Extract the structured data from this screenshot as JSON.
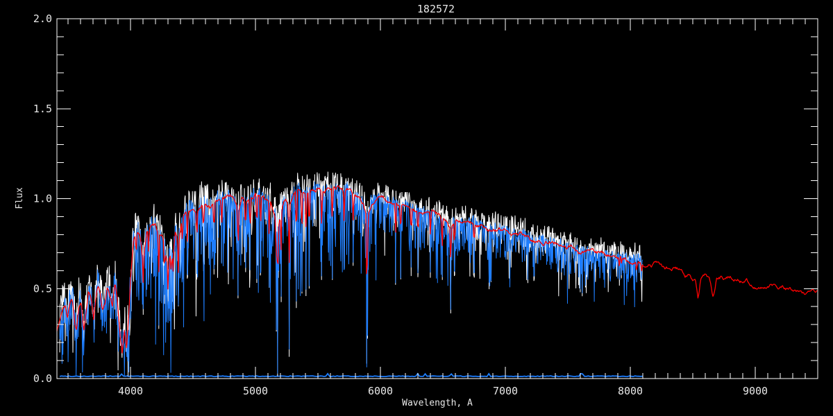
{
  "chart_data": {
    "type": "line",
    "title": "182572",
    "xlabel": "Wavelength, A",
    "ylabel": "Flux",
    "xlim": [
      3411,
      9500
    ],
    "ylim": [
      0.0,
      2.0
    ],
    "x_major_ticks": [
      4000,
      5000,
      6000,
      7000,
      8000,
      9000
    ],
    "x_minor_step": 100,
    "y_major_ticks": [
      0.0,
      0.5,
      1.0,
      1.5,
      2.0
    ],
    "y_tick_labels": [
      "0.0",
      "0.5",
      "1.0",
      "1.5",
      "2.0"
    ],
    "y_minor_step": 0.1,
    "legend": "none",
    "grid": false,
    "colors": {
      "background": "#000000",
      "axis": "#ffffff",
      "text": "#e8e8e8",
      "observed": "#1e7eff",
      "raw": "#ffffff",
      "model": "#ff0000"
    },
    "series": [
      {
        "name": "model-template",
        "color": "#ff0000",
        "kind": "model",
        "points": [
          [
            3412,
            0.26
          ],
          [
            3435,
            0.33
          ],
          [
            3455,
            0.38
          ],
          [
            3475,
            0.4
          ],
          [
            3495,
            0.34
          ],
          [
            3515,
            0.42
          ],
          [
            3535,
            0.44
          ],
          [
            3555,
            0.31
          ],
          [
            3570,
            0.28
          ],
          [
            3585,
            0.4
          ],
          [
            3605,
            0.43
          ],
          [
            3625,
            0.27
          ],
          [
            3645,
            0.36
          ],
          [
            3665,
            0.48
          ],
          [
            3685,
            0.44
          ],
          [
            3705,
            0.33
          ],
          [
            3725,
            0.46
          ],
          [
            3740,
            0.52
          ],
          [
            3755,
            0.48
          ],
          [
            3775,
            0.38
          ],
          [
            3795,
            0.42
          ],
          [
            3815,
            0.52
          ],
          [
            3835,
            0.46
          ],
          [
            3855,
            0.4
          ],
          [
            3875,
            0.52
          ],
          [
            3895,
            0.42
          ],
          [
            3915,
            0.26
          ],
          [
            3933,
            0.15
          ],
          [
            3950,
            0.28
          ],
          [
            3968,
            0.18
          ],
          [
            3985,
            0.35
          ],
          [
            4005,
            0.6
          ],
          [
            4025,
            0.77
          ],
          [
            4050,
            0.82
          ],
          [
            4075,
            0.8
          ],
          [
            4101,
            0.66
          ],
          [
            4130,
            0.82
          ],
          [
            4160,
            0.85
          ],
          [
            4200,
            0.86
          ],
          [
            4230,
            0.8
          ],
          [
            4260,
            0.78
          ],
          [
            4300,
            0.63
          ],
          [
            4320,
            0.7
          ],
          [
            4340,
            0.68
          ],
          [
            4360,
            0.82
          ],
          [
            4383,
            0.75
          ],
          [
            4410,
            0.88
          ],
          [
            4440,
            0.92
          ],
          [
            4470,
            0.94
          ],
          [
            4500,
            0.95
          ],
          [
            4530,
            0.93
          ],
          [
            4570,
            0.97
          ],
          [
            4600,
            0.98
          ],
          [
            4640,
            0.96
          ],
          [
            4680,
            0.98
          ],
          [
            4720,
            1.0
          ],
          [
            4760,
            1.01
          ],
          [
            4800,
            1.02
          ],
          [
            4830,
            1.0
          ],
          [
            4861,
            0.93
          ],
          [
            4890,
            1.0
          ],
          [
            4920,
            0.98
          ],
          [
            4957,
            1.0
          ],
          [
            5000,
            1.02
          ],
          [
            5040,
            1.01
          ],
          [
            5080,
            0.99
          ],
          [
            5120,
            0.98
          ],
          [
            5167,
            0.89
          ],
          [
            5185,
            0.86
          ],
          [
            5210,
            0.96
          ],
          [
            5240,
            1.0
          ],
          [
            5270,
            0.94
          ],
          [
            5300,
            1.03
          ],
          [
            5340,
            1.06
          ],
          [
            5380,
            1.04
          ],
          [
            5420,
            1.03
          ],
          [
            5460,
            1.05
          ],
          [
            5500,
            1.06
          ],
          [
            5540,
            1.04
          ],
          [
            5580,
            1.05
          ],
          [
            5620,
            1.05
          ],
          [
            5660,
            1.06
          ],
          [
            5700,
            1.04
          ],
          [
            5740,
            1.05
          ],
          [
            5780,
            1.03
          ],
          [
            5820,
            1.01
          ],
          [
            5860,
            0.98
          ],
          [
            5893,
            0.89
          ],
          [
            5930,
            0.99
          ],
          [
            5970,
            1.0
          ],
          [
            6010,
            1.0
          ],
          [
            6060,
            0.99
          ],
          [
            6110,
            0.97
          ],
          [
            6160,
            0.96
          ],
          [
            6220,
            0.95
          ],
          [
            6280,
            0.93
          ],
          [
            6340,
            0.92
          ],
          [
            6400,
            0.91
          ],
          [
            6460,
            0.9
          ],
          [
            6520,
            0.89
          ],
          [
            6563,
            0.84
          ],
          [
            6610,
            0.89
          ],
          [
            6670,
            0.88
          ],
          [
            6730,
            0.87
          ],
          [
            6800,
            0.85
          ],
          [
            6870,
            0.83
          ],
          [
            6940,
            0.83
          ],
          [
            7000,
            0.82
          ],
          [
            7060,
            0.81
          ],
          [
            7130,
            0.8
          ],
          [
            7200,
            0.78
          ],
          [
            7270,
            0.77
          ],
          [
            7340,
            0.76
          ],
          [
            7410,
            0.75
          ],
          [
            7480,
            0.74
          ],
          [
            7550,
            0.72
          ],
          [
            7620,
            0.7
          ],
          [
            7690,
            0.71
          ],
          [
            7760,
            0.69
          ],
          [
            7830,
            0.68
          ],
          [
            7900,
            0.67
          ],
          [
            7970,
            0.66
          ],
          [
            8040,
            0.66
          ],
          [
            8100,
            0.65
          ],
          [
            8160,
            0.64
          ],
          [
            8220,
            0.63
          ],
          [
            8280,
            0.62
          ],
          [
            8340,
            0.61
          ],
          [
            8400,
            0.6
          ],
          [
            8440,
            0.58
          ],
          [
            8470,
            0.59
          ],
          [
            8498,
            0.55
          ],
          [
            8520,
            0.58
          ],
          [
            8542,
            0.47
          ],
          [
            8562,
            0.57
          ],
          [
            8600,
            0.58
          ],
          [
            8630,
            0.57
          ],
          [
            8662,
            0.46
          ],
          [
            8690,
            0.56
          ],
          [
            8720,
            0.57
          ],
          [
            8760,
            0.56
          ],
          [
            8800,
            0.57
          ],
          [
            8840,
            0.55
          ],
          [
            8880,
            0.54
          ],
          [
            8920,
            0.55
          ],
          [
            8960,
            0.53
          ],
          [
            9000,
            0.52
          ],
          [
            9050,
            0.51
          ],
          [
            9100,
            0.52
          ],
          [
            9150,
            0.52
          ],
          [
            9200,
            0.51
          ],
          [
            9250,
            0.5
          ],
          [
            9300,
            0.5
          ],
          [
            9350,
            0.48
          ],
          [
            9395,
            0.46
          ],
          [
            9430,
            0.49
          ],
          [
            9470,
            0.48
          ],
          [
            9500,
            0.48
          ]
        ]
      },
      {
        "name": "observed-raw",
        "color": "#ffffff",
        "kind": "noisy",
        "range": [
          3433,
          8100
        ],
        "seed": 7,
        "deep_prob": 0.03,
        "up_boost": 0.05,
        "down_scale": 0.85,
        "offset": 0.012,
        "line_extra_depth": 0.015
      },
      {
        "name": "observed-corrected",
        "color": "#1e7eff",
        "kind": "noisy",
        "range": [
          3433,
          8100
        ],
        "seed": 42,
        "deep_prob": 0.045,
        "up_boost": 0,
        "down_scale": 1,
        "offset": 0,
        "line_extra_depth": 0
      },
      {
        "name": "zero-baseline",
        "color": "#1e7eff",
        "kind": "baseline",
        "range": [
          3433,
          8100
        ],
        "level": 0.013,
        "spikes": [
          3930,
          5577,
          6300,
          6364,
          6563,
          6867,
          7600,
          7621
        ]
      }
    ],
    "noise_regions": [
      [
        3980,
        0.1,
        0.22
      ],
      [
        4700,
        0.075,
        0.4
      ],
      [
        5400,
        0.05,
        0.33
      ],
      [
        6000,
        0.045,
        0.27
      ],
      [
        6800,
        0.04,
        0.22
      ],
      [
        7600,
        0.04,
        0.19
      ],
      [
        8101,
        0.04,
        0.16
      ]
    ],
    "absorption_lines": [
      [
        3933,
        0.15,
        "s"
      ],
      [
        3968,
        0.17,
        "s"
      ],
      [
        4045,
        0.55,
        "s"
      ],
      [
        4101,
        0.38,
        "s"
      ],
      [
        4144,
        0.52,
        "s"
      ],
      [
        4226,
        0.28,
        "s"
      ],
      [
        4271,
        0.45,
        "s"
      ],
      [
        4300,
        0.32,
        "s"
      ],
      [
        4325,
        0.42,
        "s"
      ],
      [
        4340,
        0.44,
        "s"
      ],
      [
        4383,
        0.4,
        "s"
      ],
      [
        4415,
        0.55,
        "s"
      ],
      [
        4455,
        0.58,
        "s"
      ],
      [
        4531,
        0.58,
        "s"
      ],
      [
        4584,
        0.62,
        "s"
      ],
      [
        4668,
        0.6,
        "s"
      ],
      [
        4730,
        0.65,
        "s"
      ],
      [
        4861,
        0.45,
        "s"
      ],
      [
        4920,
        0.62,
        "s"
      ],
      [
        4957,
        0.6,
        "s"
      ],
      [
        5010,
        0.55,
        "s"
      ],
      [
        5041,
        0.6,
        "s"
      ],
      [
        5110,
        0.52,
        "s"
      ],
      [
        5167,
        0.28,
        "s"
      ],
      [
        5178,
        0.02,
        "s"
      ],
      [
        5205,
        0.45,
        "s"
      ],
      [
        5270,
        0.15,
        "s"
      ],
      [
        5328,
        0.42,
        "s"
      ],
      [
        5371,
        0.5,
        "s"
      ],
      [
        5405,
        0.48,
        "s"
      ],
      [
        5430,
        0.52,
        "s"
      ],
      [
        5530,
        0.58,
        "s"
      ],
      [
        5615,
        0.55,
        "s"
      ],
      [
        5710,
        0.62,
        "s"
      ],
      [
        5782,
        0.65,
        "s"
      ],
      [
        5890,
        0.08,
        "s"
      ],
      [
        5896,
        0.22,
        "s"
      ],
      [
        6122,
        0.55,
        "s"
      ],
      [
        6162,
        0.55,
        "s"
      ],
      [
        6246,
        0.6,
        "s"
      ],
      [
        6300,
        0.58,
        "s"
      ],
      [
        6400,
        0.58,
        "s"
      ],
      [
        6495,
        0.55,
        "s"
      ],
      [
        6563,
        0.37,
        "s"
      ],
      [
        6593,
        0.6,
        "s"
      ],
      [
        6750,
        0.58,
        "s"
      ],
      [
        6870,
        0.52,
        "t"
      ],
      [
        6884,
        0.55,
        "t"
      ],
      [
        7180,
        0.55,
        "t"
      ],
      [
        7230,
        0.57,
        "t"
      ],
      [
        7450,
        0.58,
        "t"
      ],
      [
        7600,
        0.5,
        "t"
      ],
      [
        7615,
        0.47,
        "t"
      ],
      [
        7640,
        0.52,
        "t"
      ],
      [
        7912,
        0.55,
        "s"
      ],
      [
        7930,
        0.56,
        "s"
      ],
      [
        8050,
        0.55,
        "s"
      ],
      [
        8090,
        0.55,
        "s"
      ]
    ]
  }
}
